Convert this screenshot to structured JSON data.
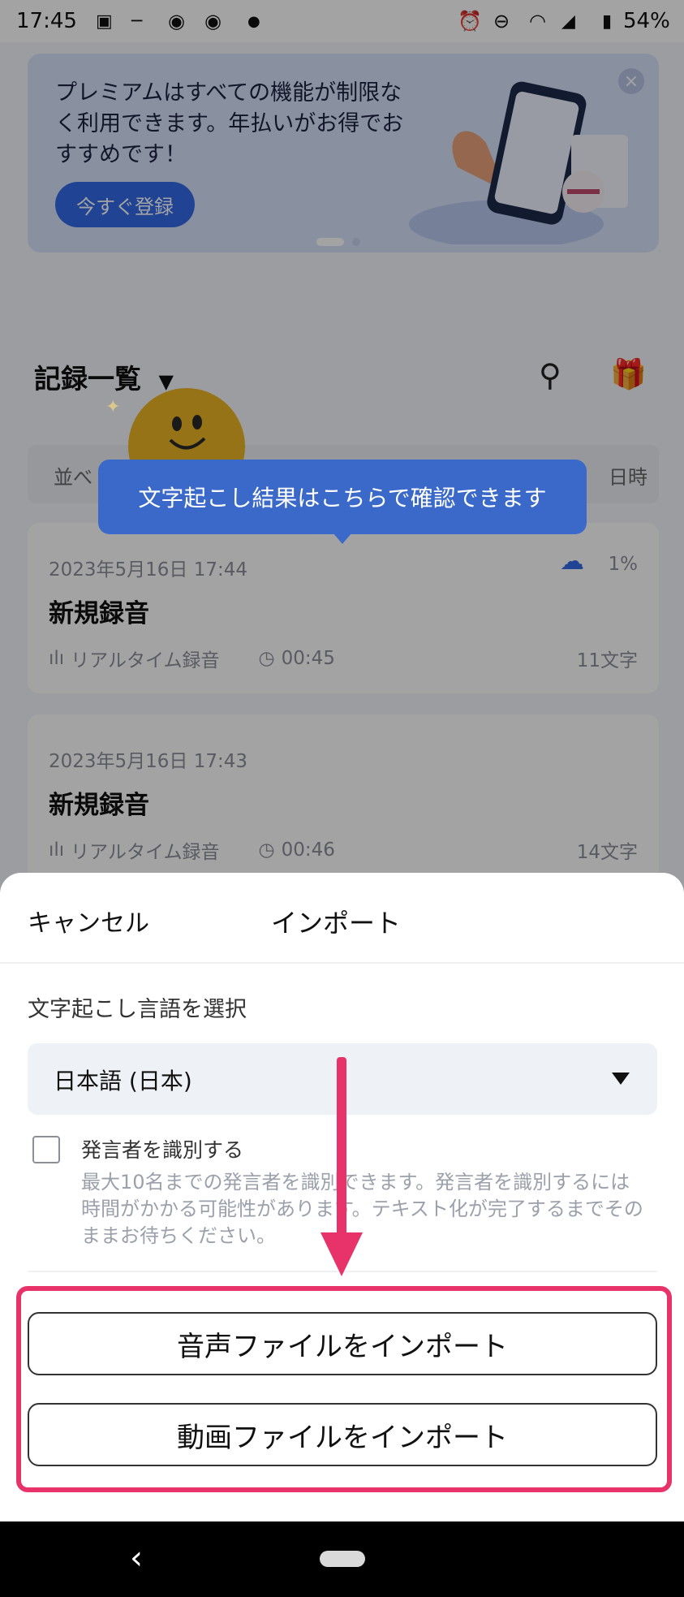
{
  "status_bar": {
    "time": "17:45",
    "battery": "54%",
    "icons": [
      "image-icon",
      "dash-icon",
      "chrome-icon",
      "chrome-icon",
      "dot-icon",
      "alarm-icon",
      "dnd-icon",
      "wifi-icon",
      "signal-icon",
      "battery-icon"
    ]
  },
  "banner": {
    "text": "プレミアムはすべての機能が制限なく利用できます。年払いがお得でおすすめです！",
    "button_label": "今すぐ登録",
    "close_glyph": "×"
  },
  "list": {
    "header": "記録一覧",
    "sort_left": "並べ",
    "sort_right": "日時"
  },
  "tooltip": "文字起こし結果はこちらで確認できます",
  "records": [
    {
      "date": "2023年5月16日  17:44",
      "title": "新規録音",
      "type": "リアルタイム録音",
      "duration": "00:45",
      "chars": "11文字",
      "upload_progress": "1%"
    },
    {
      "date": "2023年5月16日  17:43",
      "title": "新規録音",
      "type": "リアルタイム録音",
      "duration": "00:46",
      "chars": "14文字"
    }
  ],
  "sheet": {
    "cancel_label": "キャンセル",
    "title": "インポート",
    "lang_label": "文字起こし言語を選択",
    "lang_value": "日本語 (日本)",
    "speaker_label": "発言者を識別する",
    "speaker_note": "最大10名までの発言者を識別できます。発言者を識別するには時間がかかる可能性があります。テキスト化が完了するまでそのままお待ちください。",
    "speaker_checked": false,
    "import_audio_label": "音声ファイルをインポート",
    "import_video_label": "動画ファイルをインポート"
  },
  "colors": {
    "accent": "#3569e8",
    "tooltip": "#3b69c9",
    "highlight": "#e8336a"
  },
  "nav": {
    "back_glyph": "‹"
  }
}
